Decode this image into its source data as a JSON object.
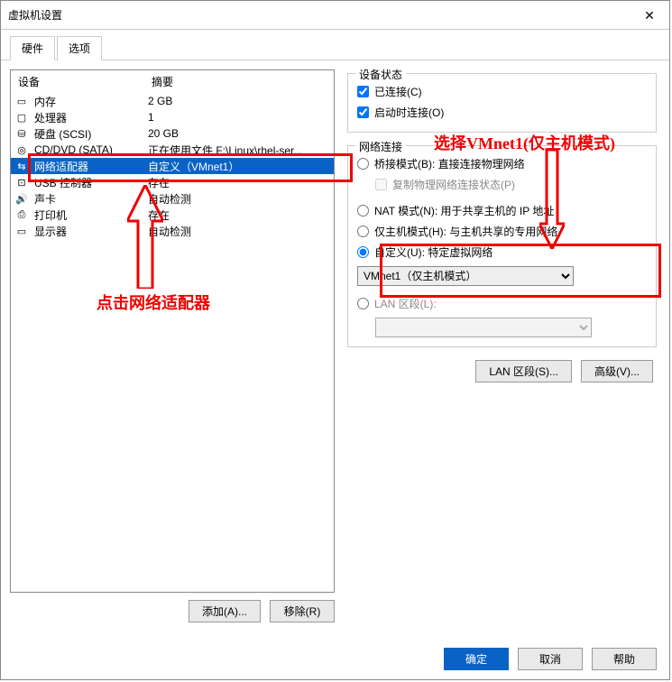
{
  "window": {
    "title": "虚拟机设置"
  },
  "tabs": {
    "hardware": "硬件",
    "options": "选项"
  },
  "device_header": {
    "col1": "设备",
    "col2": "摘要"
  },
  "devices": [
    {
      "icon": "▭",
      "name": "内存",
      "summary": "2 GB"
    },
    {
      "icon": "▢",
      "name": "处理器",
      "summary": "1"
    },
    {
      "icon": "⛁",
      "name": "硬盘 (SCSI)",
      "summary": "20 GB"
    },
    {
      "icon": "◎",
      "name": "CD/DVD (SATA)",
      "summary": "正在使用文件 F:\\Linux\\rhel-ser..."
    },
    {
      "icon": "⇆",
      "name": "网络适配器",
      "summary": "自定义（VMnet1）"
    },
    {
      "icon": "⊡",
      "name": "USB 控制器",
      "summary": "存在"
    },
    {
      "icon": "🔊",
      "name": "声卡",
      "summary": "自动检测"
    },
    {
      "icon": "⎙",
      "name": "打印机",
      "summary": "存在"
    },
    {
      "icon": "▭",
      "name": "显示器",
      "summary": "自动检测"
    }
  ],
  "left_buttons": {
    "add": "添加(A)...",
    "remove": "移除(R)"
  },
  "status_group": {
    "legend": "设备状态",
    "connected": "已连接(C)",
    "connect_on": "启动时连接(O)"
  },
  "net_group": {
    "legend": "网络连接",
    "bridged": "桥接模式(B): 直接连接物理网络",
    "replicate": "复制物理网络连接状态(P)",
    "nat": "NAT 模式(N): 用于共享主机的 IP 地址",
    "hostonly": "仅主机模式(H): 与主机共享的专用网络",
    "custom": "自定义(U): 特定虚拟网络",
    "custom_select": "VMnet1（仅主机模式）",
    "lan_segment": "LAN 区段(L):",
    "btn_lan": "LAN 区段(S)...",
    "btn_adv": "高级(V)..."
  },
  "bottom": {
    "ok": "确定",
    "cancel": "取消",
    "help": "帮助"
  },
  "annotations": {
    "note1": "点击网络适配器",
    "note2": "选择VMnet1(仅主机模式)"
  }
}
